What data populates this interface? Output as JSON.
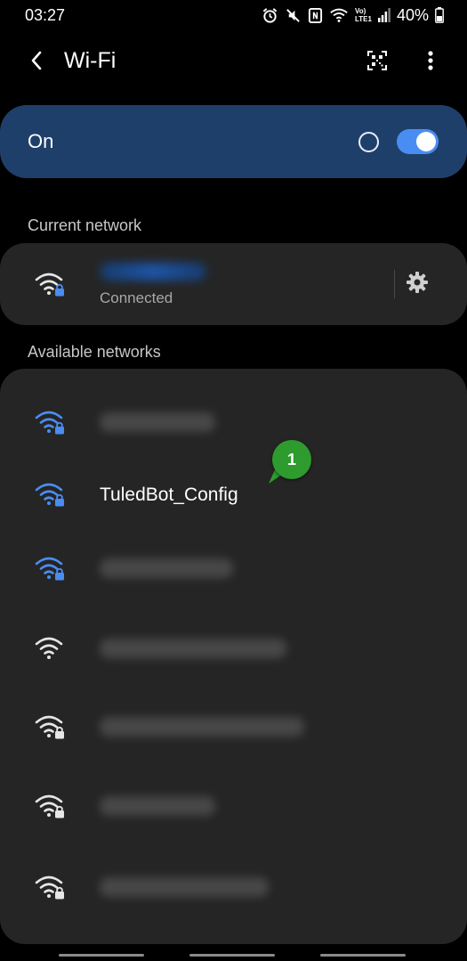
{
  "status_bar": {
    "time": "03:27",
    "battery": "40%",
    "network_label_top": "Vo)",
    "network_label_bottom": "LTE1",
    "icons": [
      "alarm-icon",
      "mute-icon",
      "nfc-icon",
      "wifi-status-icon",
      "signal-icon",
      "battery-icon"
    ]
  },
  "app_bar": {
    "title": "Wi-Fi",
    "icons": [
      "back-icon",
      "qr-scan-icon",
      "more-options-icon"
    ]
  },
  "toggle": {
    "label": "On",
    "enabled": true
  },
  "colors": {
    "accent": "#4a8df2",
    "toggle_card": "#1f3f6b",
    "card": "#252525",
    "badge": "#2e9b2e"
  },
  "current_network": {
    "header": "Current network",
    "name": "",
    "status": "Connected",
    "secured": true
  },
  "available_networks": {
    "header": "Available networks",
    "items": [
      {
        "name": "",
        "secured": true,
        "signal_color": "#4a8df2",
        "blurred": true
      },
      {
        "name": "TuledBot_Config",
        "secured": true,
        "signal_color": "#4a8df2",
        "blurred": false
      },
      {
        "name": "",
        "secured": true,
        "signal_color": "#4a8df2",
        "blurred": true
      },
      {
        "name": "",
        "secured": false,
        "signal_color": "#e6e6e6",
        "blurred": true
      },
      {
        "name": "",
        "secured": true,
        "signal_color": "#e6e6e6",
        "blurred": true
      },
      {
        "name": "",
        "secured": true,
        "signal_color": "#e6e6e6",
        "blurred": true
      },
      {
        "name": "",
        "secured": true,
        "signal_color": "#e6e6e6",
        "blurred": true
      }
    ]
  },
  "annotation": {
    "badge": "1"
  }
}
